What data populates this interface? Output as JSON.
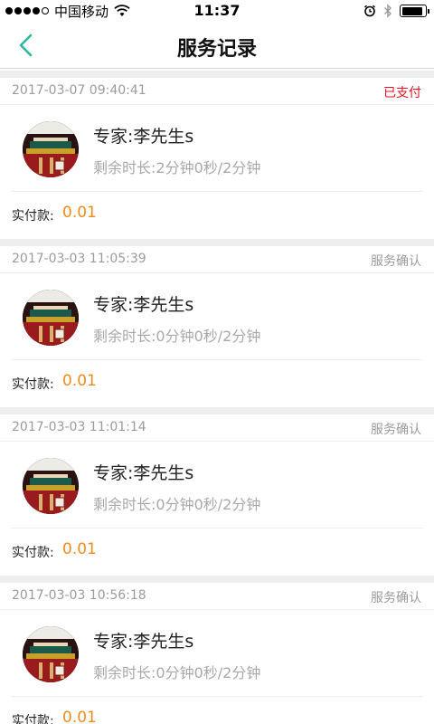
{
  "status_bar": {
    "carrier": "中国移动",
    "time": "11:37",
    "signal_dots_filled": 4,
    "battery_level": 0.88
  },
  "nav": {
    "title": "服务记录",
    "back_icon": "chevron-left-icon",
    "back_color": "#2bb79b"
  },
  "colors": {
    "paid_status": "#e0161e",
    "amount": "#f08c1e",
    "muted": "#9b9b9b"
  },
  "records": [
    {
      "date": "2017-03-07 09:40:41",
      "status": "已支付",
      "expert": "专家:李先生s",
      "remaining": "剩余时长:2分钟0秒/2分钟",
      "paid_label": "实付款:",
      "amount": "0.01"
    },
    {
      "date": "2017-03-03 11:05:39",
      "status": "服务确认",
      "expert": "专家:李先生s",
      "remaining": "剩余时长:0分钟0秒/2分钟",
      "paid_label": "实付款:",
      "amount": "0.01"
    },
    {
      "date": "2017-03-03 11:01:14",
      "status": "服务确认",
      "expert": "专家:李先生s",
      "remaining": "剩余时长:0分钟0秒/2分钟",
      "paid_label": "实付款:",
      "amount": "0.01"
    },
    {
      "date": "2017-03-03 10:56:18",
      "status": "服务确认",
      "expert": "专家:李先生s",
      "remaining": "剩余时长:0分钟0秒/2分钟",
      "paid_label": "实付款:",
      "amount": "0.01"
    }
  ]
}
